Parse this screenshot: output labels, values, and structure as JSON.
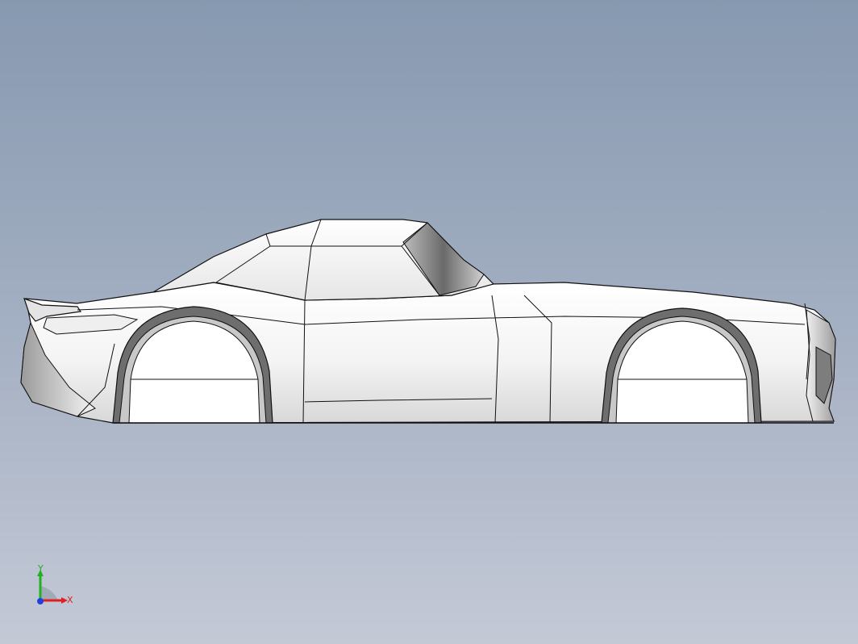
{
  "viewport": {
    "background_top": "#8799b0",
    "background_bottom": "#c4c9d6",
    "model": {
      "name": "car-body",
      "shading": "shaded-with-edges",
      "body_color": "#f2f2f2",
      "edge_color": "#111111"
    }
  },
  "triad": {
    "x_label": "X",
    "y_label": "Y",
    "x_color": "#e02020",
    "y_color": "#20b020",
    "z_color": "#2040e0"
  }
}
